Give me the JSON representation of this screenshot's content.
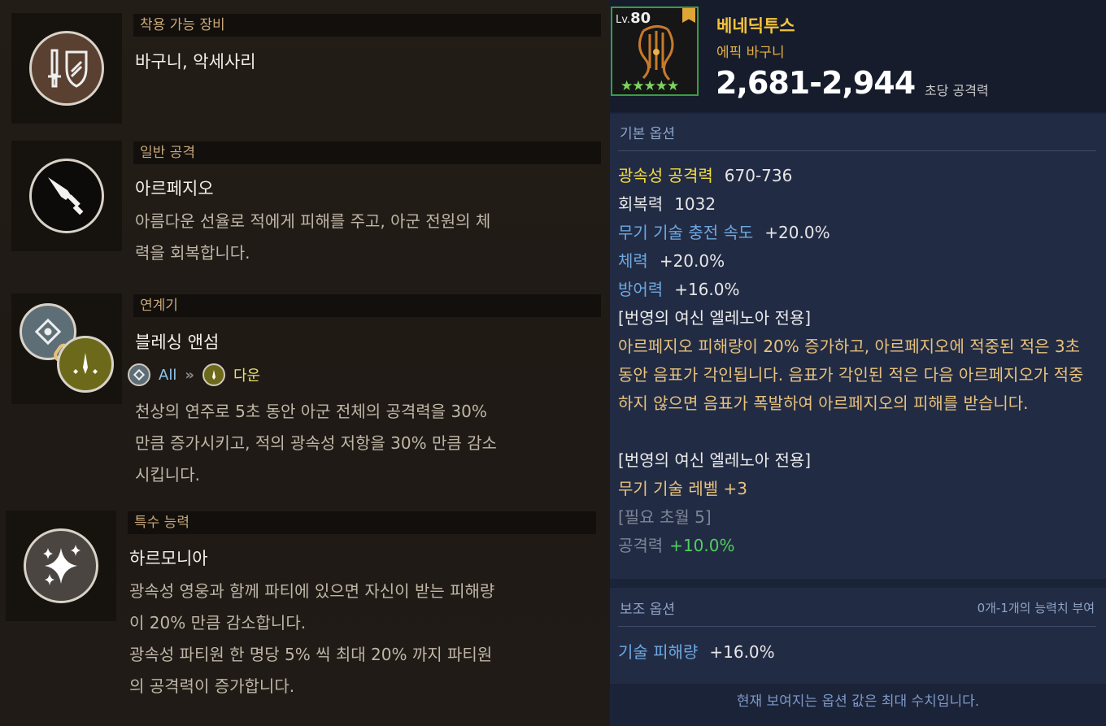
{
  "sections": [
    {
      "header": "착용 가능 장비",
      "title": "바구니, 악세사리",
      "desc": ""
    },
    {
      "header": "일반 공격",
      "title": "아르페지오",
      "desc": "아름다운 선율로 적에게 피해를 주고, 아군 전원의 체\n력을 회복합니다."
    },
    {
      "header": "연계기",
      "title": "블레싱 앤섬",
      "link_from": "All",
      "link_to": "다운",
      "desc": "천상의 연주로 5초 동안 아군 전체의 공격력을 30%\n만큼 증가시키고, 적의 광속성 저항을 30% 만큼 감소\n시킵니다."
    },
    {
      "header": "특수 능력",
      "title": "하르모니아",
      "desc": "광속성 영웅과 함께 파티에 있으면 자신이 받는 피해량\n이 20% 만큼 감소합니다.\n광속성 파티원 한 명당 5% 씩 최대 20% 까지 파티원\n의 공격력이 증가합니다."
    }
  ],
  "item": {
    "level_label": "Lv.",
    "level": "80",
    "stars": "★★★★★",
    "name": "베네딕투스",
    "type": "에픽 바구니",
    "attack": "2,681-2,944",
    "attack_label": "초당 공격력"
  },
  "basic_options": {
    "label": "기본 옵션",
    "lines": [
      {
        "key": "광속성 공격력",
        "value": "670-736"
      },
      {
        "key": "회복력",
        "value": "1032"
      },
      {
        "key": "무기 기술 충전 속도",
        "value": "+20.0%"
      },
      {
        "key": "체력",
        "value": "+20.0%"
      },
      {
        "key": "방어력",
        "value": "+16.0%"
      }
    ],
    "lore1_title": "[번영의 여신 엘레노아 전용]",
    "lore1_text": "아르페지오 피해량이 20% 증가하고, 아르페지오에 적중된 적은 3초 동안 음표가 각인됩니다. 음표가 각인된 적은 다음 아르페지오가 적중하지 않으면 음표가 폭발하여 아르페지오의 피해를 받습니다.",
    "lore2_title": "[번영의 여신 엘레노아 전용]",
    "lore2_text": "무기 기술 레벨 +3",
    "required": "[필요 초월 5]",
    "bonus_key": "공격력",
    "bonus_value": "+10.0%"
  },
  "sub_options": {
    "label": "보조 옵션",
    "note": "0개-1개의 능력치 부여",
    "key": "기술 피해량",
    "value": "+16.0%"
  },
  "footer": "현재 보여지는 옵션 값은 최대 수치입니다.",
  "colors": {
    "gold": "#f3c33b",
    "lore": "#e8c27c",
    "green": "#4fd05a",
    "blue": "#6ea8e0",
    "panel": "#222b44"
  }
}
